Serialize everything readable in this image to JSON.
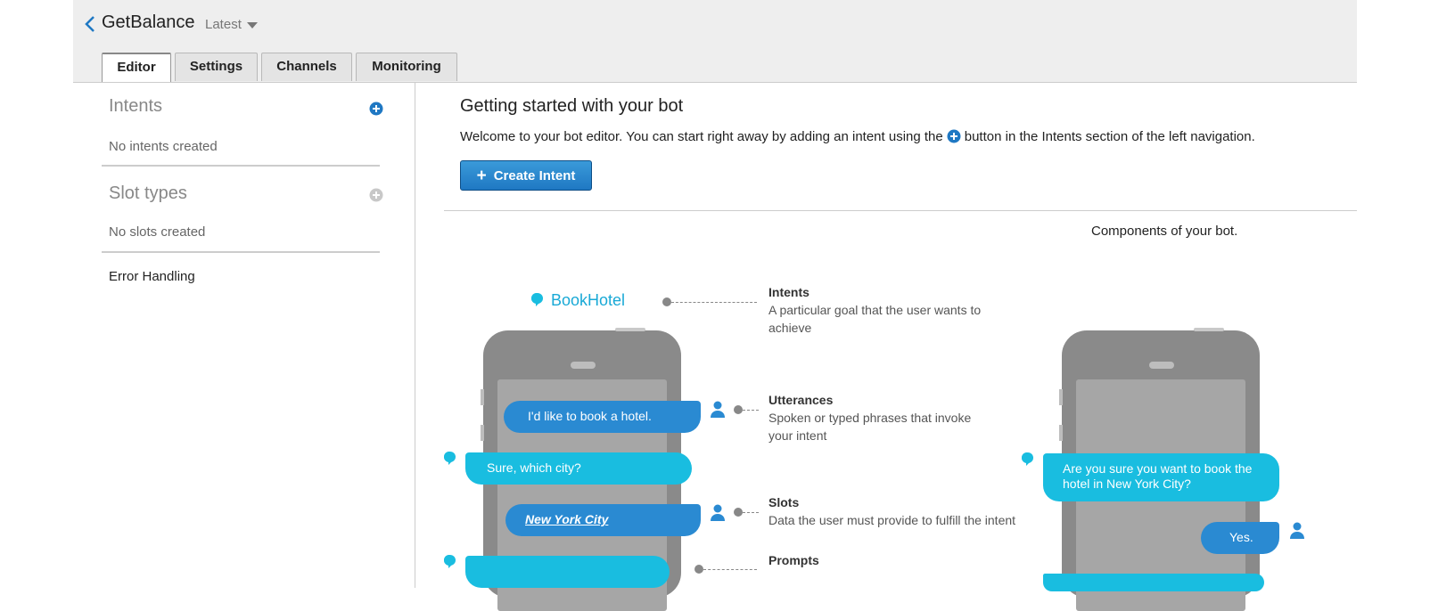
{
  "header": {
    "back_icon": "chevron-left-icon",
    "bot_name": "GetBalance",
    "version_label": "Latest",
    "tabs": [
      {
        "label": "Editor",
        "active": true
      },
      {
        "label": "Settings",
        "active": false
      },
      {
        "label": "Channels",
        "active": false
      },
      {
        "label": "Monitoring",
        "active": false
      }
    ]
  },
  "sidebar": {
    "intents_heading": "Intents",
    "intents_empty": "No intents created",
    "slot_types_heading": "Slot types",
    "slots_empty": "No slots created",
    "error_handling": "Error Handling",
    "add_icon": "plus-circle-icon"
  },
  "main": {
    "title": "Getting started with your bot",
    "welcome_before": "Welcome to your bot editor. You can start right away by adding an intent using the",
    "welcome_after": "button in the Intents section of the left navigation.",
    "create_button": "Create Intent",
    "components_label": "Components of your bot."
  },
  "diagram": {
    "intent_name": "BookHotel",
    "labels": [
      {
        "title": "Intents",
        "desc": "A particular goal that the user wants to achieve"
      },
      {
        "title": "Utterances",
        "desc": "Spoken or typed phrases that invoke your intent"
      },
      {
        "title": "Slots",
        "desc": "Data the user must provide to fulfill the intent"
      },
      {
        "title": "Prompts",
        "desc": ""
      }
    ],
    "bubbles_left": [
      {
        "text": "I'd like to book a hotel.",
        "role": "user"
      },
      {
        "text": "Sure, which city?",
        "role": "bot"
      },
      {
        "text": "New York City",
        "role": "user"
      },
      {
        "text": "",
        "role": "bot"
      }
    ],
    "bubbles_right": [
      {
        "text": "Are you sure you want to book the hotel in New York City?",
        "role": "bot"
      },
      {
        "text": "Yes.",
        "role": "user"
      }
    ]
  },
  "colors": {
    "accent": "#1f78c3",
    "user_bubble": "#2a8ad2",
    "bot_bubble": "#19bde0",
    "phone": "#8a8a8a"
  }
}
